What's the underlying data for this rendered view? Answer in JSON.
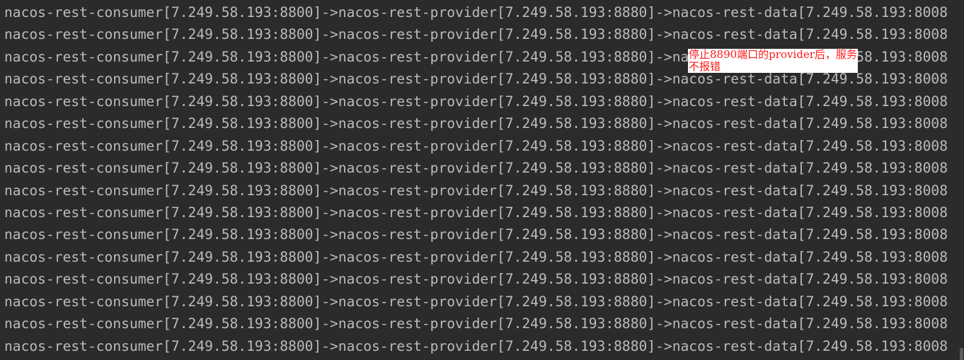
{
  "console": {
    "lines": [
      "nacos-rest-consumer[7.249.58.193:8800]->nacos-rest-provider[7.249.58.193:8880]->nacos-rest-data[7.249.58.193:8008",
      "nacos-rest-consumer[7.249.58.193:8800]->nacos-rest-provider[7.249.58.193:8880]->nacos-rest-data[7.249.58.193:8008",
      "nacos-rest-consumer[7.249.58.193:8800]->nacos-rest-provider[7.249.58.193:8880]->nacos-rest-data[7.249.58.193:8008",
      "nacos-rest-consumer[7.249.58.193:8800]->nacos-rest-provider[7.249.58.193:8880]->nacos-rest-data[7.249.58.193:8008",
      "nacos-rest-consumer[7.249.58.193:8800]->nacos-rest-provider[7.249.58.193:8880]->nacos-rest-data[7.249.58.193:8008",
      "nacos-rest-consumer[7.249.58.193:8800]->nacos-rest-provider[7.249.58.193:8880]->nacos-rest-data[7.249.58.193:8008",
      "nacos-rest-consumer[7.249.58.193:8800]->nacos-rest-provider[7.249.58.193:8880]->nacos-rest-data[7.249.58.193:8008",
      "nacos-rest-consumer[7.249.58.193:8800]->nacos-rest-provider[7.249.58.193:8880]->nacos-rest-data[7.249.58.193:8008",
      "nacos-rest-consumer[7.249.58.193:8800]->nacos-rest-provider[7.249.58.193:8880]->nacos-rest-data[7.249.58.193:8008",
      "nacos-rest-consumer[7.249.58.193:8800]->nacos-rest-provider[7.249.58.193:8880]->nacos-rest-data[7.249.58.193:8008",
      "nacos-rest-consumer[7.249.58.193:8800]->nacos-rest-provider[7.249.58.193:8880]->nacos-rest-data[7.249.58.193:8008",
      "nacos-rest-consumer[7.249.58.193:8800]->nacos-rest-provider[7.249.58.193:8880]->nacos-rest-data[7.249.58.193:8008",
      "nacos-rest-consumer[7.249.58.193:8800]->nacos-rest-provider[7.249.58.193:8880]->nacos-rest-data[7.249.58.193:8008",
      "nacos-rest-consumer[7.249.58.193:8800]->nacos-rest-provider[7.249.58.193:8880]->nacos-rest-data[7.249.58.193:8008",
      "nacos-rest-consumer[7.249.58.193:8800]->nacos-rest-provider[7.249.58.193:8880]->nacos-rest-data[7.249.58.193:8008",
      "nacos-rest-consumer[7.249.58.193:8800]->nacos-rest-provider[7.249.58.193:8880]->nacos-rest-data[7.249.58.193:8008"
    ]
  },
  "annotation": {
    "line1": "停止8890端口的provider后，服务",
    "line2": "不报错"
  },
  "colors": {
    "background": "#2b2b2b",
    "text": "#bbbbbb",
    "annotation_text": "#ff1a1a",
    "annotation_background": "#ffffff"
  }
}
